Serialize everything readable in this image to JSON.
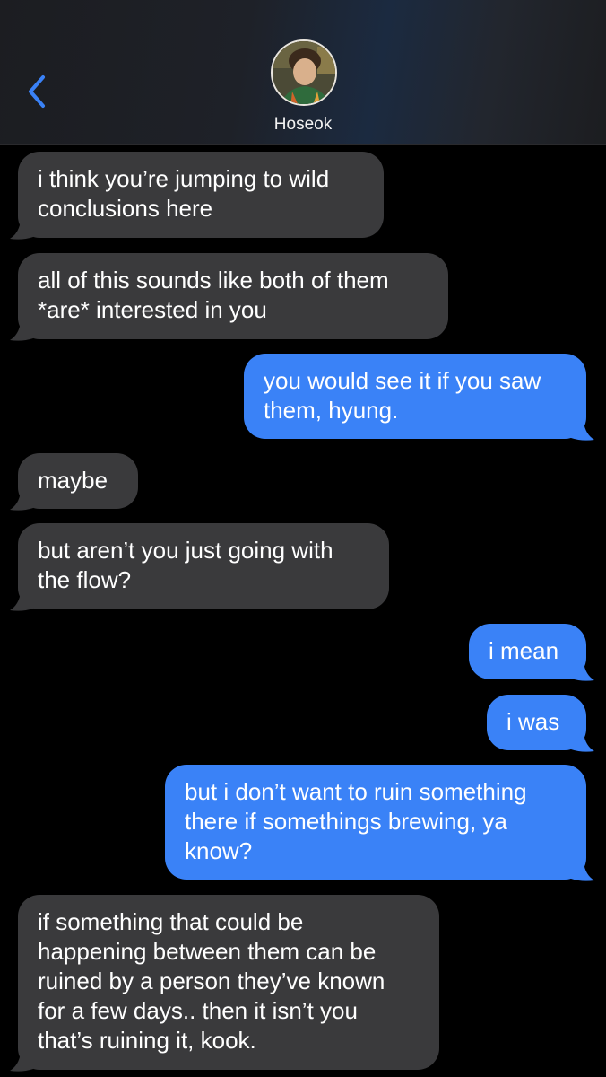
{
  "header": {
    "contact_name": "Hoseok",
    "back_icon": "chevron-left-icon"
  },
  "colors": {
    "incoming_bubble": "#3a3a3c",
    "outgoing_bubble": "#3a82f7",
    "accent": "#3a82f7"
  },
  "messages": [
    {
      "sender": "them",
      "text": "i think you’re jumping to wild\nconclusions here"
    },
    {
      "sender": "them",
      "text": "all of this sounds like both of them\n*are* interested in you"
    },
    {
      "sender": "me",
      "text": "you would see it if you saw\nthem, hyung."
    },
    {
      "sender": "them",
      "text": "maybe"
    },
    {
      "sender": "them",
      "text": "but aren’t you just going with\nthe flow?"
    },
    {
      "sender": "me",
      "text": "i mean"
    },
    {
      "sender": "me",
      "text": "i was"
    },
    {
      "sender": "me",
      "text": "but i don’t want to ruin something\nthere if somethings brewing, ya\nknow?"
    },
    {
      "sender": "them",
      "text": "if something that could be\nhappening between them can be\nruined by a person they’ve known\nfor a few days.. then it isn’t you\nthat’s ruining it, kook."
    }
  ]
}
